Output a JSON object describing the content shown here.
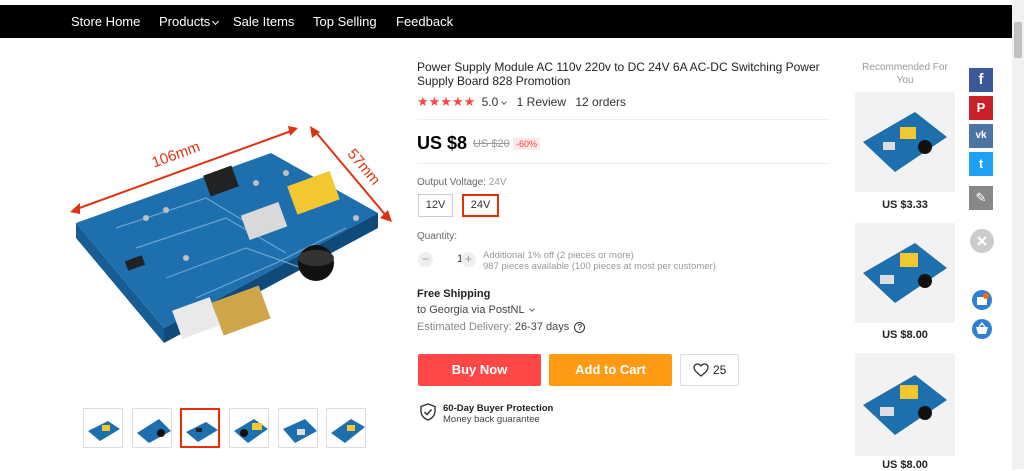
{
  "nav": {
    "items": [
      "Store Home",
      "Products",
      "Sale Items",
      "Top Selling",
      "Feedback"
    ]
  },
  "product": {
    "title": "Power Supply Module AC 110v 220v to DC 24V 6A AC-DC Switching Power Supply Board 828 Promotion",
    "image_label_length": "106mm",
    "image_label_width": "57mm",
    "rating": {
      "stars_glyph": "★★★★★",
      "score": "5.0",
      "reviews": "1 Review",
      "orders": "12 orders"
    },
    "price": "US $8",
    "old_price": "US $20",
    "discount": "-60%",
    "variant": {
      "label": "Output Voltage:",
      "selected_value": "24V",
      "options": [
        "12V",
        "24V"
      ]
    },
    "quantity": {
      "label": "Quantity:",
      "value": "1",
      "minus": "−",
      "plus": "+",
      "note1": "Additional 1% off (2 pieces or more)",
      "note2": "987 pieces available (100 pieces at most per customer)"
    },
    "shipping": {
      "title": "Free Shipping",
      "destination": "to Georgia via PostNL",
      "delivery_label": "Estimated Delivery:",
      "delivery_value": "26-37 days"
    },
    "buttons": {
      "buy_now": "Buy Now",
      "add_to_cart": "Add to Cart",
      "wishlist_count": "25"
    },
    "protection": {
      "title": "60-Day Buyer Protection",
      "subtitle": "Money back guarantee"
    }
  },
  "recommended": {
    "title": "Recommended For You",
    "prices": [
      "US $3.33",
      "US $8.00",
      "US $8.00"
    ]
  },
  "social": {
    "facebook": "f",
    "pinterest": "P",
    "vk": "vk",
    "twitter": "t",
    "edit": "✎"
  },
  "colors": {
    "accent_red": "#ff4747",
    "accent_orange": "#ff9a14",
    "star": "#ff4444",
    "facebook": "#3b5998",
    "pinterest": "#cb2027",
    "vk": "#4c75a3",
    "twitter": "#1da1f2"
  }
}
